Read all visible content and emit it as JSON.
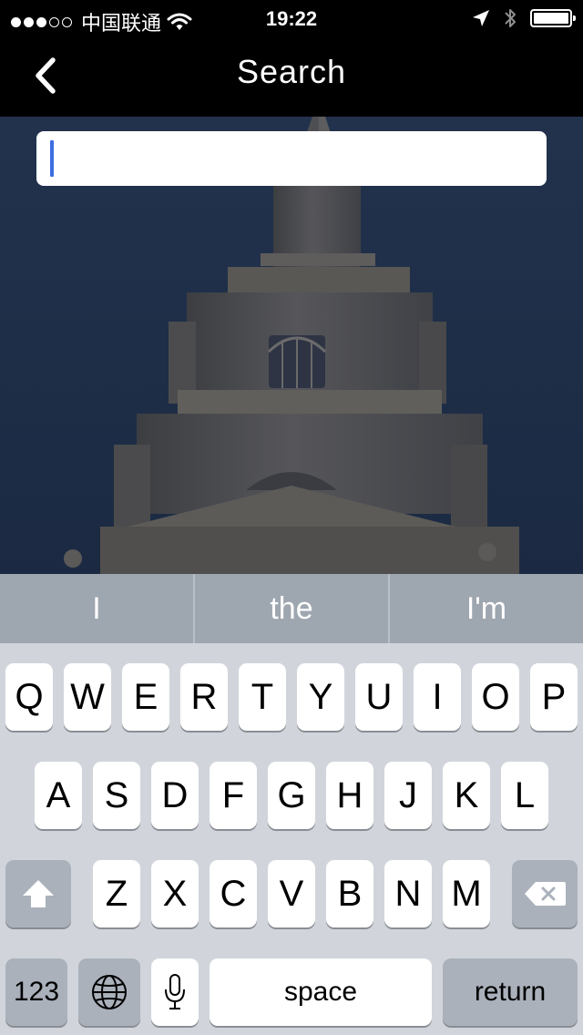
{
  "status_bar": {
    "carrier": "中国联通",
    "time": "19:22",
    "signal_bars": 3,
    "signal_total": 5,
    "battery_level": 1.0
  },
  "nav": {
    "title": "Search",
    "back_icon": "chevron-left-icon"
  },
  "search": {
    "value": "",
    "placeholder": ""
  },
  "suggestions": [
    "I",
    "the",
    "I'm"
  ],
  "keyboard": {
    "row1": [
      "Q",
      "W",
      "E",
      "R",
      "T",
      "Y",
      "U",
      "I",
      "O",
      "P"
    ],
    "row2": [
      "A",
      "S",
      "D",
      "F",
      "G",
      "H",
      "J",
      "K",
      "L"
    ],
    "row3": [
      "Z",
      "X",
      "C",
      "V",
      "B",
      "N",
      "M"
    ],
    "numbers_label": "123",
    "space_label": "space",
    "return_label": "return",
    "shift_icon": "shift-icon",
    "delete_icon": "delete-icon",
    "globe_icon": "globe-icon",
    "mic_icon": "microphone-icon"
  },
  "colors": {
    "caret": "#3c6ee0",
    "keyboard_bg": "#d1d5db",
    "suggestion_bg": "#9ea6b0"
  }
}
